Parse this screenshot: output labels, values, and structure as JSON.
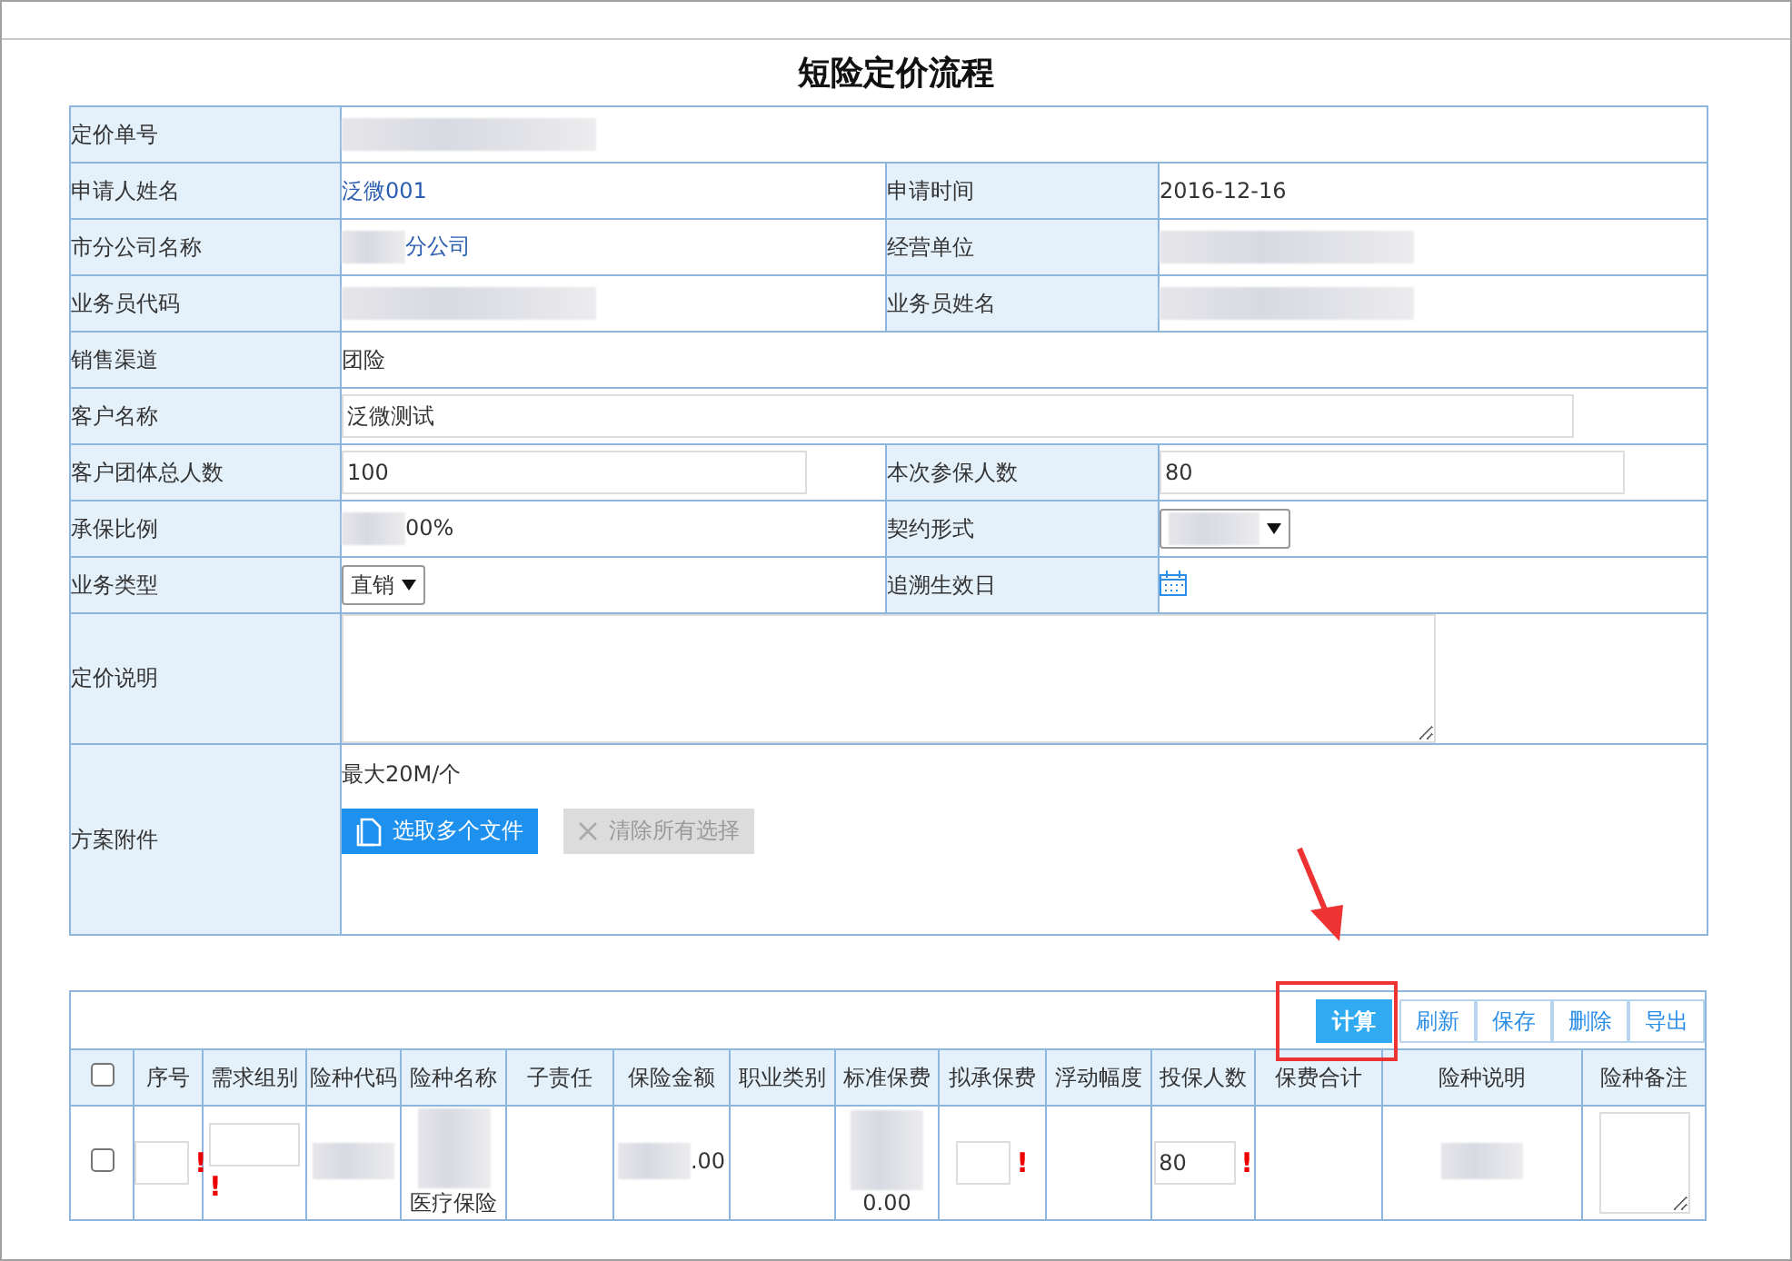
{
  "title": "短险定价流程",
  "form": {
    "rows": [
      [
        {
          "label": "定价单号",
          "kind": "text",
          "redacted": true
        }
      ],
      [
        {
          "label": "申请人姓名",
          "kind": "link",
          "value": "泛微001"
        },
        {
          "label": "申请时间",
          "kind": "text",
          "value": "2016-12-16"
        }
      ],
      [
        {
          "label": "市分公司名称",
          "kind": "link",
          "value": "分公司",
          "redacted": true
        },
        {
          "label": "经营单位",
          "kind": "link",
          "redacted": true
        }
      ],
      [
        {
          "label": "业务员代码",
          "kind": "text",
          "redacted": true
        },
        {
          "label": "业务员姓名",
          "kind": "text",
          "redacted": true
        }
      ],
      [
        {
          "label": "销售渠道",
          "kind": "text",
          "value": "团险"
        }
      ],
      [
        {
          "label": "客户名称",
          "kind": "input",
          "value": "泛微测试"
        }
      ],
      [
        {
          "label": "客户团体总人数",
          "kind": "input",
          "value": "100"
        },
        {
          "label": "本次参保人数",
          "kind": "input",
          "value": "80"
        }
      ],
      [
        {
          "label": "承保比例",
          "kind": "text",
          "value": "00%",
          "redacted": true
        },
        {
          "label": "契约形式",
          "kind": "select",
          "redacted": true
        }
      ],
      [
        {
          "label": "业务类型",
          "kind": "select",
          "value": "直销"
        },
        {
          "label": "追溯生效日",
          "kind": "date"
        }
      ],
      [
        {
          "label": "定价说明",
          "kind": "textarea"
        }
      ],
      [
        {
          "label": "方案附件",
          "kind": "upload",
          "note": "最大20M/个",
          "buttons": [
            {
              "label": "选取多个文件",
              "disabled": false
            },
            {
              "label": "清除所有选择",
              "disabled": true
            }
          ]
        }
      ]
    ]
  },
  "grid": {
    "toolbar": [
      {
        "label": "计算",
        "primary": true,
        "highlighted": true
      },
      {
        "label": "刷新",
        "primary": false,
        "highlighted": false
      },
      {
        "label": "保存",
        "primary": false,
        "highlighted": false
      },
      {
        "label": "删除",
        "primary": false,
        "highlighted": false
      },
      {
        "label": "导出",
        "primary": false,
        "highlighted": false
      }
    ],
    "select_all": {
      "checked": false
    },
    "columns": [
      "序号",
      "需求组别",
      "险种代码",
      "险种名称",
      "子责任",
      "保险金额",
      "职业类别",
      "标准保费",
      "拟承保费",
      "浮动幅度",
      "投保人数",
      "保费合计",
      "险种说明",
      "险种备注"
    ],
    "rows": [
      {
        "checked": false,
        "cells": [
          {
            "kind": "input",
            "required_mark": "!"
          },
          {
            "kind": "input_below",
            "required_mark": "!"
          },
          {
            "kind": "text",
            "redacted": true
          },
          {
            "kind": "text",
            "value": "医疗保险",
            "redacted": true
          },
          {
            "kind": "empty"
          },
          {
            "kind": "text",
            "value": ".00",
            "redacted": true
          },
          {
            "kind": "empty"
          },
          {
            "kind": "text",
            "value": "0.00",
            "redacted": true
          },
          {
            "kind": "input",
            "required_mark": "!"
          },
          {
            "kind": "empty"
          },
          {
            "kind": "input",
            "value": "80",
            "required_mark": "!"
          },
          {
            "kind": "empty"
          },
          {
            "kind": "text",
            "redacted": true
          },
          {
            "kind": "textarea"
          }
        ]
      }
    ]
  }
}
